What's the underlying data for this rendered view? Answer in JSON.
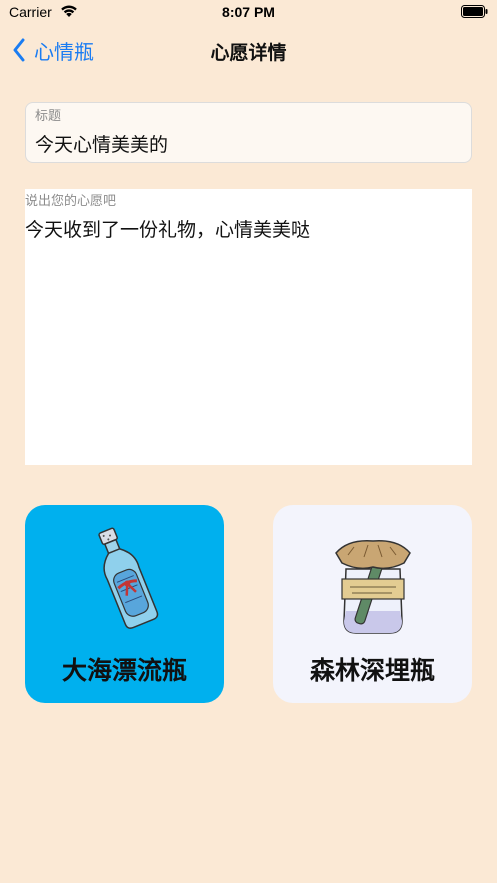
{
  "status_bar": {
    "carrier": "Carrier",
    "time": "8:07 PM"
  },
  "nav": {
    "back_label": "心情瓶",
    "title": "心愿详情"
  },
  "title_field": {
    "label": "标题",
    "value": "今天心情美美的"
  },
  "wish_field": {
    "label": "说出您的心愿吧",
    "value": "今天收到了一份礼物，心情美美哒"
  },
  "options": [
    {
      "label": "大海漂流瓶",
      "icon": "message-bottle-icon",
      "background": "#00b0ee"
    },
    {
      "label": "森林深埋瓶",
      "icon": "wish-jar-icon",
      "background": "#f3f4fc"
    }
  ],
  "colors": {
    "background": "#fbe9d5",
    "accent": "#1a7cf2"
  }
}
